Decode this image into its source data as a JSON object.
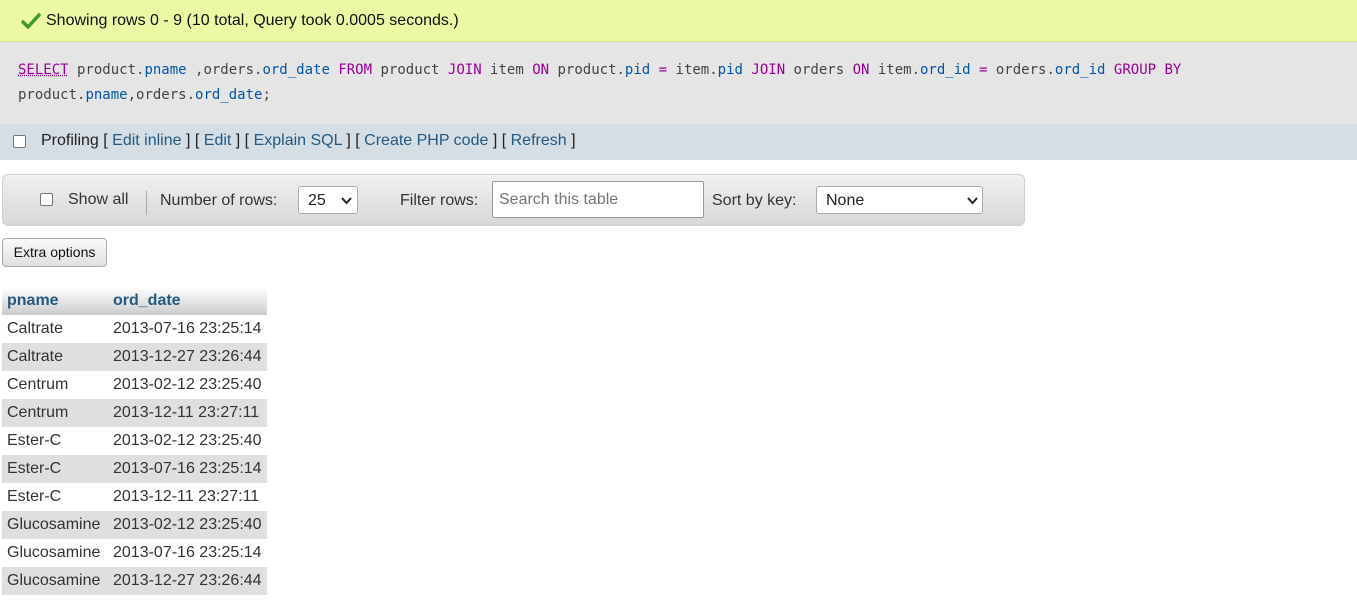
{
  "status": {
    "message": "Showing rows 0 - 9 (10 total, Query took 0.0005 seconds.)",
    "icon": "check-icon",
    "color": "#ebf8a4"
  },
  "sql": {
    "line1": [
      {
        "t": "SELECT",
        "c": "kw u"
      },
      {
        "t": " product.",
        "c": ""
      },
      {
        "t": "pname",
        "c": "fld"
      },
      {
        "t": " ,orders.",
        "c": ""
      },
      {
        "t": "ord_date",
        "c": "fld"
      },
      {
        "t": " ",
        "c": ""
      },
      {
        "t": "FROM",
        "c": "kw"
      },
      {
        "t": " product ",
        "c": ""
      },
      {
        "t": "JOIN",
        "c": "kw"
      },
      {
        "t": " item ",
        "c": ""
      },
      {
        "t": "ON",
        "c": "kw"
      },
      {
        "t": " product.",
        "c": ""
      },
      {
        "t": "pid",
        "c": "fld"
      },
      {
        "t": " ",
        "c": ""
      },
      {
        "t": "=",
        "c": "op"
      },
      {
        "t": " item.",
        "c": ""
      },
      {
        "t": "pid",
        "c": "fld"
      },
      {
        "t": " ",
        "c": ""
      },
      {
        "t": "JOIN",
        "c": "kw"
      },
      {
        "t": " orders ",
        "c": ""
      },
      {
        "t": "ON",
        "c": "kw"
      },
      {
        "t": " item.",
        "c": ""
      },
      {
        "t": "ord_id",
        "c": "fld"
      },
      {
        "t": " ",
        "c": ""
      },
      {
        "t": "=",
        "c": "op"
      },
      {
        "t": " orders.",
        "c": ""
      },
      {
        "t": "ord_id",
        "c": "fld"
      },
      {
        "t": " ",
        "c": ""
      },
      {
        "t": "GROUP BY",
        "c": "kw"
      }
    ],
    "line2": [
      {
        "t": "product.",
        "c": ""
      },
      {
        "t": "pname",
        "c": "fld"
      },
      {
        "t": ",orders.",
        "c": ""
      },
      {
        "t": "ord_date",
        "c": "fld"
      },
      {
        "t": ";",
        "c": ""
      }
    ]
  },
  "profiling": {
    "label": "Profiling",
    "links": [
      "Edit inline",
      "Edit",
      "Explain SQL",
      "Create PHP code",
      "Refresh"
    ]
  },
  "nav": {
    "show_all": "Show all",
    "num_rows_label": "Number of rows:",
    "num_rows_value": "25",
    "filter_label": "Filter rows:",
    "filter_placeholder": "Search this table",
    "sort_label": "Sort by key:",
    "sort_value": "None"
  },
  "extra_options": "Extra options",
  "table": {
    "headers": [
      "pname",
      "ord_date"
    ],
    "rows": [
      [
        "Caltrate",
        "2013-07-16 23:25:14"
      ],
      [
        "Caltrate",
        "2013-12-27 23:26:44"
      ],
      [
        "Centrum",
        "2013-02-12 23:25:40"
      ],
      [
        "Centrum",
        "2013-12-11 23:27:11"
      ],
      [
        "Ester-C",
        "2013-02-12 23:25:40"
      ],
      [
        "Ester-C",
        "2013-07-16 23:25:14"
      ],
      [
        "Ester-C",
        "2013-12-11 23:27:11"
      ],
      [
        "Glucosamine",
        "2013-02-12 23:25:40"
      ],
      [
        "Glucosamine",
        "2013-07-16 23:25:14"
      ],
      [
        "Glucosamine",
        "2013-12-27 23:26:44"
      ]
    ]
  }
}
